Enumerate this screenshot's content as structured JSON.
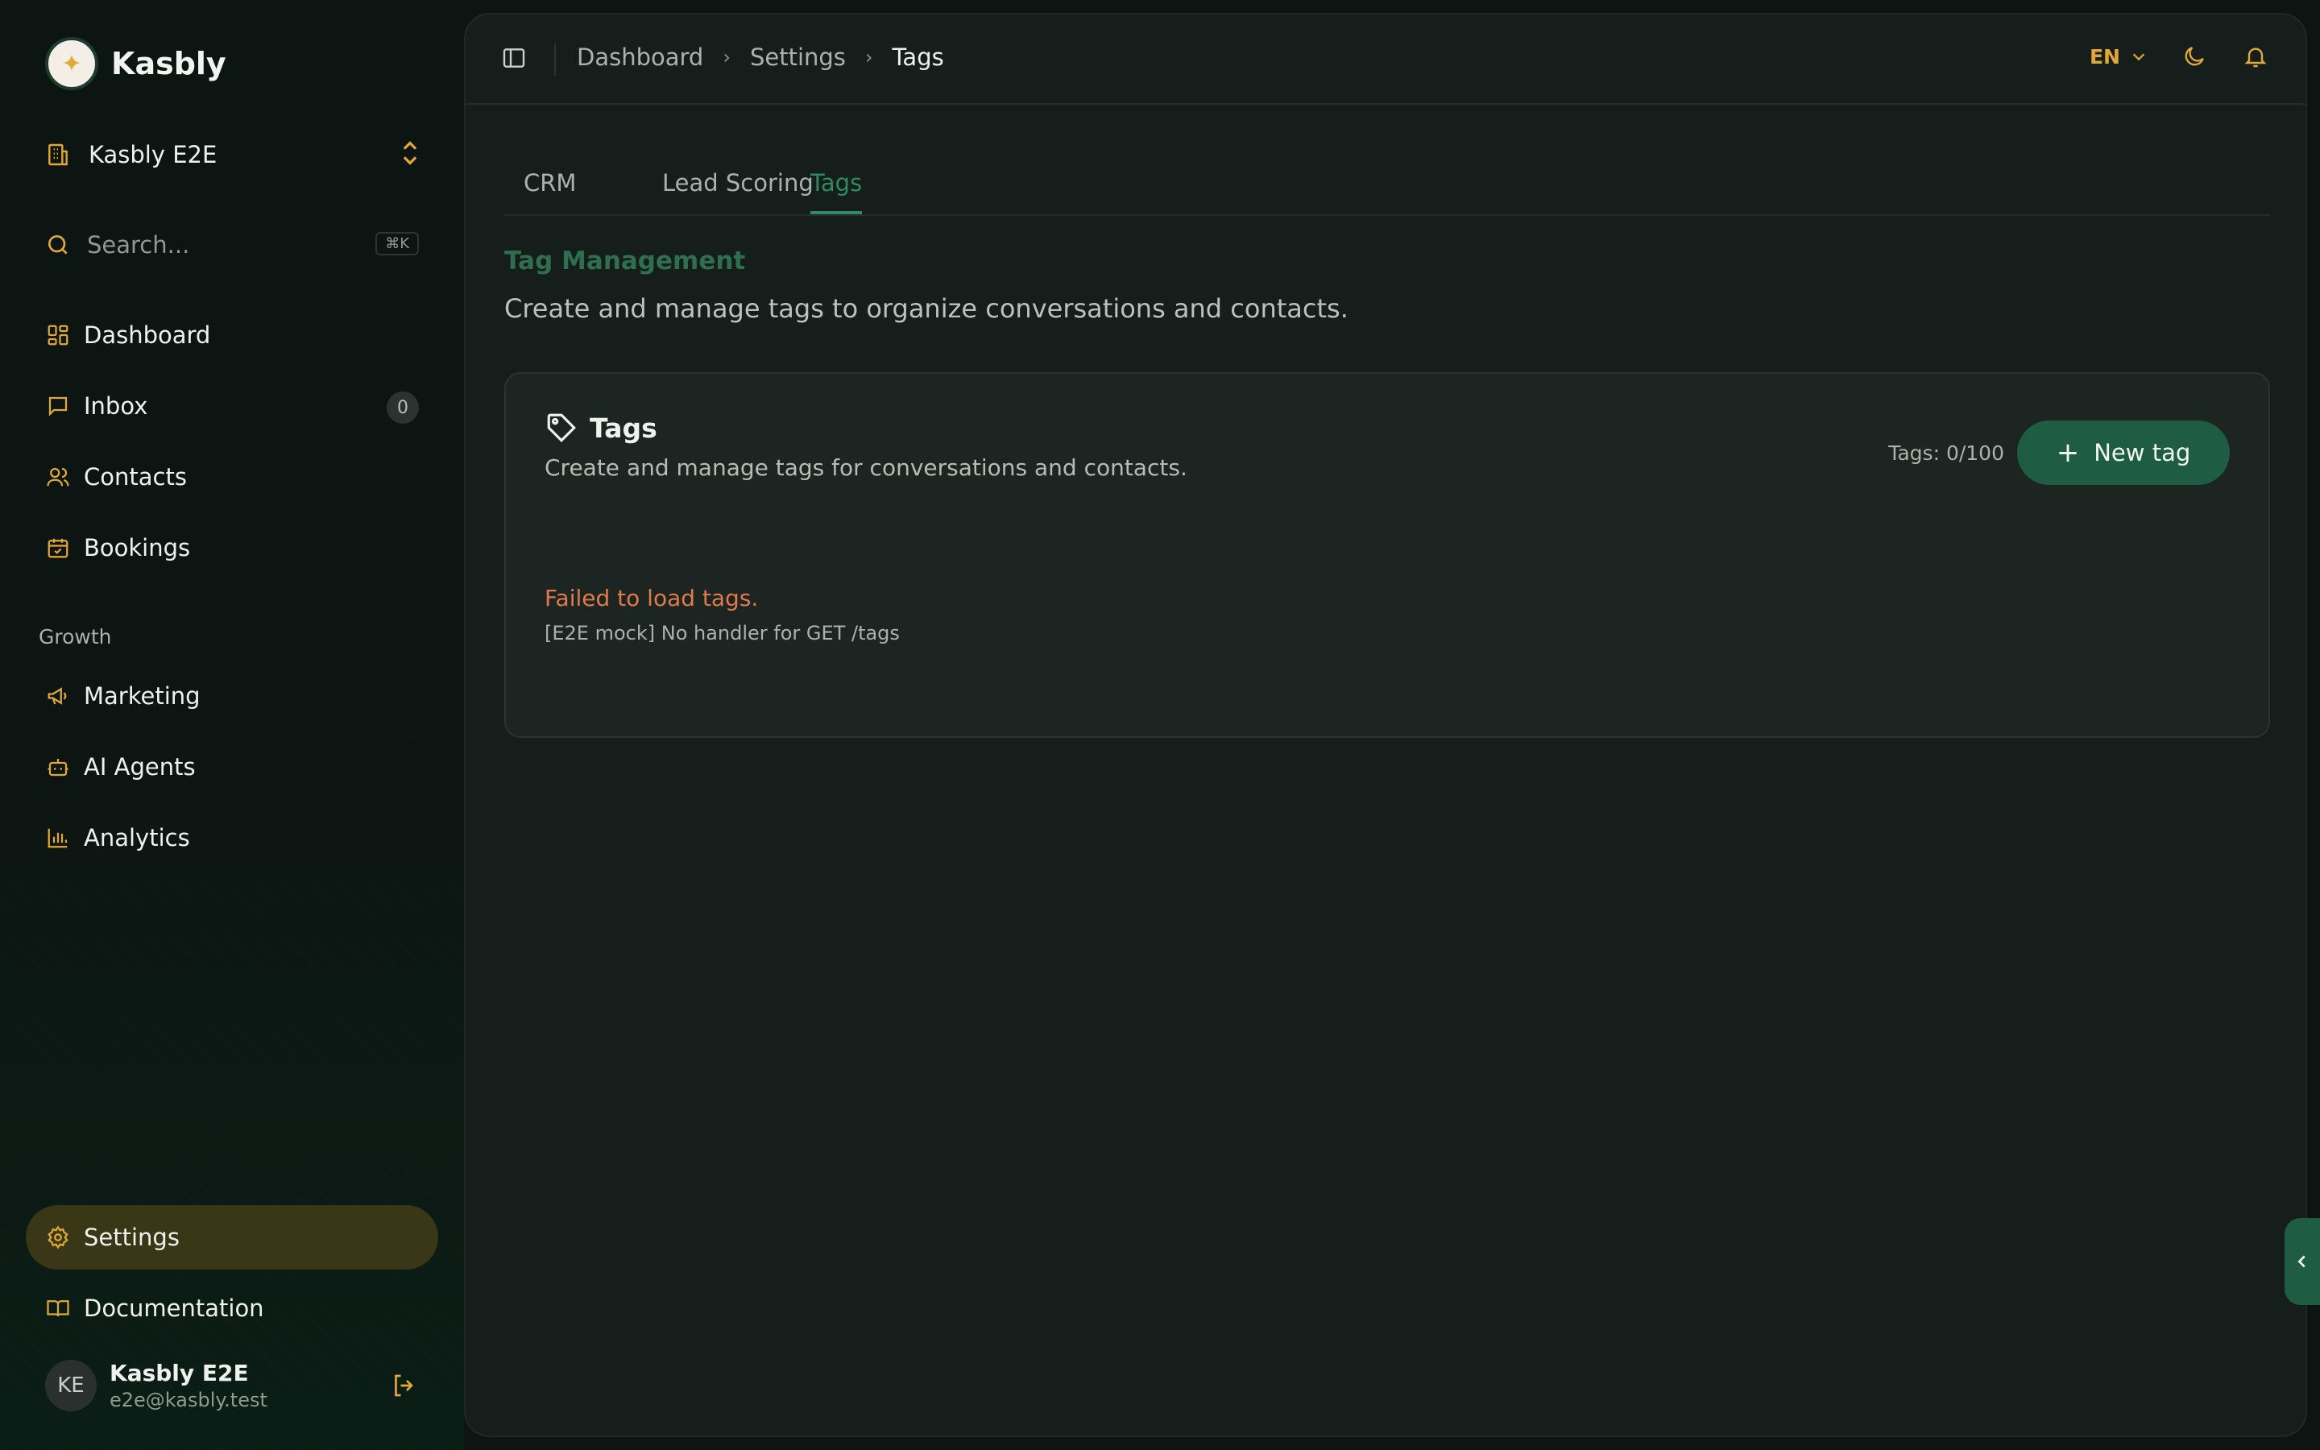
{
  "brand": {
    "name": "Kasbly"
  },
  "workspace": {
    "name": "Kasbly E2E"
  },
  "search": {
    "placeholder": "Search...",
    "shortcut": "⌘K"
  },
  "nav": {
    "dashboard": "Dashboard",
    "inbox": "Inbox",
    "inbox_count": "0",
    "contacts": "Contacts",
    "bookings": "Bookings",
    "growth_section": "Growth",
    "marketing": "Marketing",
    "ai_agents": "AI Agents",
    "analytics": "Analytics",
    "settings": "Settings",
    "documentation": "Documentation"
  },
  "user": {
    "initials": "KE",
    "name": "Kasbly E2E",
    "email": "e2e@kasbly.test"
  },
  "breadcrumb": [
    "Dashboard",
    "Settings",
    "Tags"
  ],
  "topbar": {
    "language": "EN"
  },
  "tabs": [
    "CRM",
    "Lead Scoring",
    "Tags"
  ],
  "page": {
    "title": "Tag Management",
    "subtitle": "Create and manage tags to organize conversations and contacts."
  },
  "card": {
    "title": "Tags",
    "subtitle": "Create and manage tags for conversations and contacts.",
    "count": "Tags: 0/100",
    "new_button": "New tag",
    "error_title": "Failed to load tags.",
    "error_detail": "[E2E mock] No handler for GET /tags"
  },
  "colors": {
    "accent": "#e2a836",
    "primary": "#1f5c44",
    "error": "#e07a4c"
  }
}
